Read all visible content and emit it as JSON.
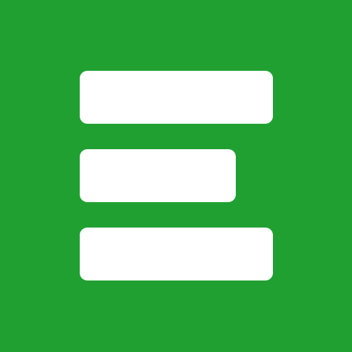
{
  "icon": {
    "name": "menu-lines-icon",
    "colors": {
      "background": "#21a032",
      "bars": "#ffffff"
    },
    "bars": [
      "long",
      "medium",
      "long"
    ]
  }
}
